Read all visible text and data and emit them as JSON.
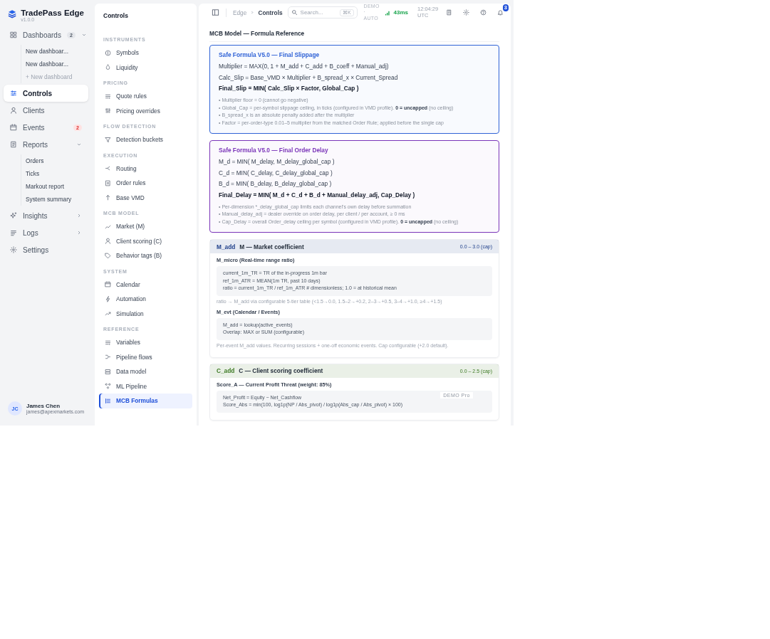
{
  "brand": {
    "name": "TradePass Edge",
    "version": "v1.0.0"
  },
  "nav": [
    {
      "label": "Dashboards",
      "selected": false,
      "expanded": true,
      "badge": {
        "text": "2",
        "kind": "neutral"
      },
      "children": [
        {
          "label": "New dashboar...",
          "kind": "link"
        },
        {
          "label": "New dashboar...",
          "kind": "link"
        },
        {
          "label": "+ New dashboard",
          "kind": "add"
        }
      ]
    },
    {
      "label": "Controls",
      "selected": true
    },
    {
      "label": "Clients",
      "selected": false
    },
    {
      "label": "Events",
      "selected": false,
      "badge": {
        "text": "2",
        "kind": "alert"
      }
    },
    {
      "label": "Reports",
      "selected": false,
      "expanded": true,
      "children": [
        {
          "label": "Orders",
          "kind": "link"
        },
        {
          "label": "Ticks",
          "kind": "link"
        },
        {
          "label": "Markout report",
          "kind": "link"
        },
        {
          "label": "System summary",
          "kind": "link"
        }
      ]
    },
    {
      "label": "Insights",
      "selected": false,
      "expanded": false
    },
    {
      "label": "Logs",
      "selected": false,
      "expanded": false
    },
    {
      "label": "Settings",
      "selected": false
    }
  ],
  "user": {
    "initials": "JC",
    "name": "James Chen",
    "email": "james@apexmarkets.com"
  },
  "subnav": {
    "title": "Controls",
    "sections": [
      {
        "title": "INSTRUMENTS",
        "items": [
          {
            "label": "Symbols",
            "selected": false
          },
          {
            "label": "Liquidity",
            "selected": false
          }
        ]
      },
      {
        "title": "PRICING",
        "items": [
          {
            "label": "Quote rules",
            "selected": false
          },
          {
            "label": "Pricing overrides",
            "selected": false
          }
        ]
      },
      {
        "title": "FLOW DETECTION",
        "items": [
          {
            "label": "Detection buckets",
            "selected": false
          }
        ]
      },
      {
        "title": "EXECUTION",
        "items": [
          {
            "label": "Routing",
            "selected": false
          },
          {
            "label": "Order rules",
            "selected": false
          },
          {
            "label": "Base VMD",
            "selected": false
          }
        ]
      },
      {
        "title": "MCB MODEL",
        "items": [
          {
            "label": "Market (M)",
            "selected": false
          },
          {
            "label": "Client scoring (C)",
            "selected": false
          },
          {
            "label": "Behavior tags (B)",
            "selected": false
          }
        ]
      },
      {
        "title": "SYSTEM",
        "items": [
          {
            "label": "Calendar",
            "selected": false
          },
          {
            "label": "Automation",
            "selected": false
          },
          {
            "label": "Simulation",
            "selected": false
          }
        ]
      },
      {
        "title": "REFERENCE",
        "items": [
          {
            "label": "Variables",
            "selected": false
          },
          {
            "label": "Pipeline flows",
            "selected": false
          },
          {
            "label": "Data model",
            "selected": false
          },
          {
            "label": "ML Pipeline",
            "selected": false
          },
          {
            "label": "MCB Formulas",
            "selected": true
          }
        ]
      }
    ]
  },
  "topbar": {
    "breadcrumb": [
      "Edge",
      "Controls"
    ],
    "search": {
      "placeholder": "Search...",
      "shortcut": "⌘K"
    },
    "mode": "DEMO · AUTO",
    "latency": "43ms",
    "time": "12:04:29 UTC",
    "notifications": "3"
  },
  "page": {
    "title": "MCB Model — Formula Reference",
    "formulas": [
      {
        "title": "Safe Formula V5.0 — Final Slippage",
        "color": "#2f62d6",
        "lines": [
          {
            "text": "Multiplier = MAX(0, 1 + M_add + C_add + B_coeff + Manual_adj)",
            "emphasis": false
          },
          {
            "text": "Calc_Slip = Base_VMD × Multiplier + B_spread_x × Current_Spread",
            "emphasis": false
          },
          {
            "text": "Final_Slip = MIN( Calc_Slip × Factor, Global_Cap )",
            "emphasis": true
          }
        ],
        "notes": [
          "• Multiplier floor = 0 (cannot go negative)",
          "• Global_Cap = per-symbol slippage ceiling, in ticks (configured in VMD profile). **0 = uncapped** (no ceiling)",
          "• B_spread_x is an absolute penalty added after the multiplier",
          "• Factor = per-order-type 0.01–5 multiplier from the matched Order Rule; applied before the single cap"
        ]
      },
      {
        "title": "Safe Formula V5.0 — Final Order Delay",
        "color": "#7a34b8",
        "lines": [
          {
            "text": "M_d = MIN( M_delay, M_delay_global_cap )",
            "emphasis": false
          },
          {
            "text": "C_d = MIN( C_delay, C_delay_global_cap )",
            "emphasis": false
          },
          {
            "text": "B_d = MIN( B_delay, B_delay_global_cap )",
            "emphasis": false
          },
          {
            "text": "Final_Delay = MIN( M_d + C_d + B_d + Manual_delay_adj, Cap_Delay )",
            "emphasis": true
          }
        ],
        "notes": [
          "• Per-dimension *_delay_global_cap limits each channel's own delay before summation",
          "• Manual_delay_adj = dealer override on order delay, per client / per account, ≥ 0 ms",
          "• Cap_Delay = overall Order_delay ceiling per symbol (configured in VMD profile). **0 = uncapped** (no ceiling)"
        ]
      }
    ],
    "coefficients": [
      {
        "code": "M_add",
        "title": "M — Market coefficient",
        "range": "0.0 – 3.0 (cap)",
        "color": "#1e3f8a",
        "blocks": [
          {
            "title": "M_micro (Real-time range ratio)",
            "code": [
              "current_1m_TR = TR of the in-progress 1m bar",
              "ref_1m_ATR = MEAN(1m TR, past 10 days)",
              "ratio = current_1m_TR / ref_1m_ATR   # dimensionless; 1.0 = at historical mean"
            ],
            "note": "ratio → M_add via configurable 5-tier table (<1.5→0.0, 1.5–2→+0.2, 2–3→+0.5, 3–4→+1.0, ≥4→+1.5)"
          },
          {
            "title": "M_evt (Calendar / Events)",
            "code": [
              "M_add = lookup(active_events)",
              "Overlap: MAX or SUM (configurable)"
            ],
            "note": "Per-event M_add values. Recurring sessions + one-off economic events. Cap configurable (+2.0 default)."
          }
        ]
      },
      {
        "code": "C_add",
        "title": "C — Client scoring coefficient",
        "range": "0.0 – 2.5 (cap)",
        "color": "#3d7a24",
        "stamp": "DEMO Pro",
        "blocks": [
          {
            "title": "Score_A — Current Profit Threat (weight: 85%)",
            "code": [
              "Net_Profit = Equity − Net_Cashflow",
              "Score_Abs = min(100, log1p(NP / Abs_pivot) / log1p(Abs_cap / Abs_pivot) × 100)"
            ]
          }
        ]
      }
    ]
  }
}
